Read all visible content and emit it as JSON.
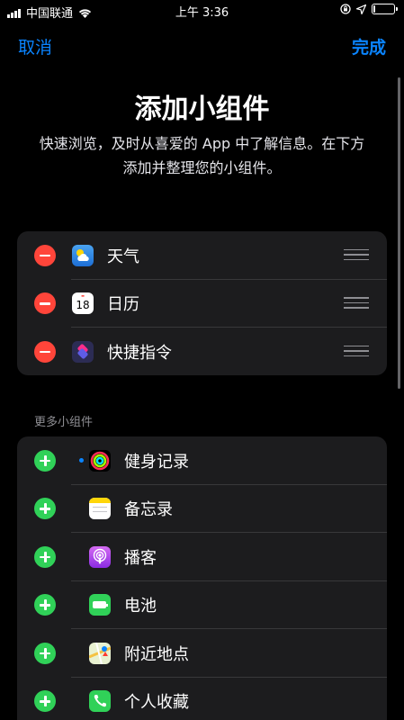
{
  "status_bar": {
    "carrier": "中国联通",
    "time": "上午 3:36"
  },
  "nav": {
    "cancel_label": "取消",
    "done_label": "完成"
  },
  "header": {
    "title": "添加小组件",
    "subtitle": "快速浏览，及时从喜爱的 App 中了解信息。在下方添加并整理您的小组件。"
  },
  "active_widgets": [
    {
      "label": "天气",
      "icon": "weather-icon"
    },
    {
      "label": "日历",
      "icon": "calendar-icon",
      "icon_text": "18"
    },
    {
      "label": "快捷指令",
      "icon": "shortcuts-icon"
    }
  ],
  "more_section": {
    "header": "更多小组件",
    "items": [
      {
        "label": "健身记录",
        "icon": "fitness-icon",
        "new": true
      },
      {
        "label": "备忘录",
        "icon": "notes-icon"
      },
      {
        "label": "播客",
        "icon": "podcasts-icon"
      },
      {
        "label": "电池",
        "icon": "battery-icon"
      },
      {
        "label": "附近地点",
        "icon": "maps-icon"
      },
      {
        "label": "个人收藏",
        "icon": "phone-icon"
      }
    ]
  },
  "colors": {
    "accent": "#0a84ff",
    "remove": "#ff453a",
    "add": "#30d158",
    "card_bg": "#1c1c1e"
  }
}
